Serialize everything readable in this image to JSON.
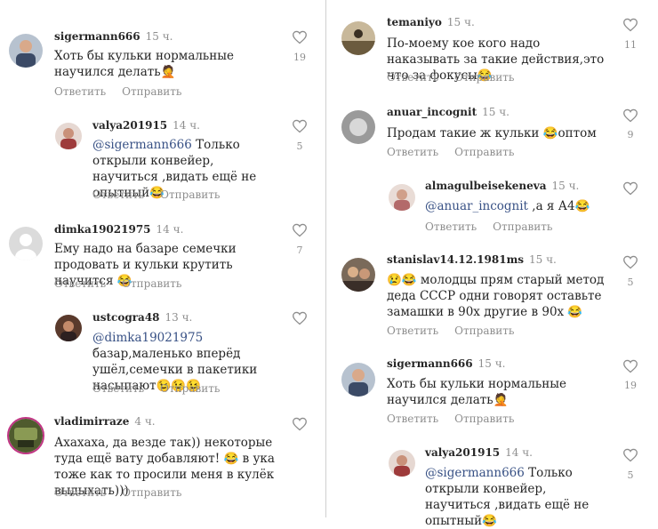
{
  "labels": {
    "reply": "Ответить",
    "send": "Отправить"
  },
  "left": [
    {
      "user": "sigermann666",
      "time": "15 ч.",
      "mention": "",
      "text": "Хоть бы кульки нормальные научился делать🤦",
      "likes": "19"
    },
    {
      "user": "valya201915",
      "time": "14 ч.",
      "mention": "@sigermann666",
      "text": " Только открыли конвейер, научиться ,видать ещё не опытный😂",
      "likes": "5"
    },
    {
      "user": "dimka19021975",
      "time": "14 ч.",
      "mention": "",
      "text": "Ему надо на базаре семечки продовать и кульки крутить научится 😂",
      "likes": "7"
    },
    {
      "user": "ustcogra48",
      "time": "13 ч.",
      "mention": "@dimka19021975",
      "text": " базар,маленько вперёд ушёл,семечки в  пакетики насыпают😉😉😉",
      "likes": ""
    },
    {
      "user": "vladimirraze",
      "time": "4 ч.",
      "mention": "",
      "text": "Ахахаха, да везде так)) некоторые туда ещё вату добавляют! 😂 в ука тоже как то просили меня в кулёк выдыхать)))",
      "likes": ""
    }
  ],
  "right": [
    {
      "user": "temaniyo",
      "time": "15 ч.",
      "mention": "",
      "text": "По-моему кое кого надо наказывать за такие действия,это что за фокусы😂",
      "likes": "11"
    },
    {
      "user": "anuar_incognit",
      "time": "15 ч.",
      "mention": "",
      "text": "Продам такие ж кульки 😂оптом",
      "likes": "9"
    },
    {
      "user": "almagulbeisekeneva",
      "time": "15 ч.",
      "mention": "@anuar_incognit",
      "text": " ,а я А4😂",
      "likes": ""
    },
    {
      "user": "stanislav14.12.1981ms",
      "time": "15 ч.",
      "mention": "",
      "text": "😢😂 молодцы прям старый метод деда СССР одни говорят оставьте замашки в 90х другие в 90х 😂",
      "likes": "5"
    },
    {
      "user": "sigermann666",
      "time": "15 ч.",
      "mention": "",
      "text": "Хоть бы кульки нормальные научился делать🤦",
      "likes": "19"
    },
    {
      "user": "valya201915",
      "time": "14 ч.",
      "mention": "@sigermann666",
      "text": " Только открыли конвейер, научиться ,видать ещё не опытный😂",
      "likes": "5"
    }
  ]
}
